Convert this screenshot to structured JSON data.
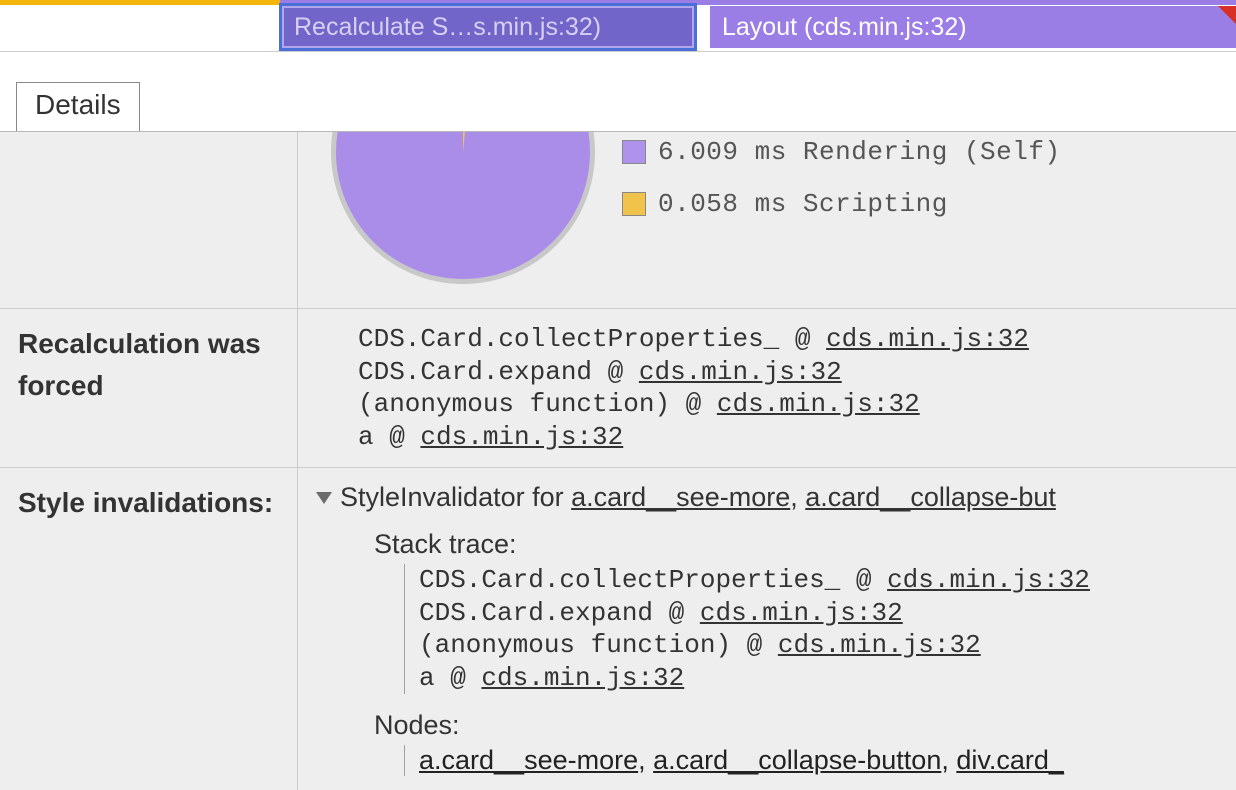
{
  "colors": {
    "rendering": "#af92eb",
    "scripting": "#f2c34b",
    "accent_scripting_bar": "#f3b509",
    "accent_rendering_bar": "#9a7ee6"
  },
  "timeline": {
    "recalc_label": "Recalculate S…s.min.js:32)",
    "layout_label": "Layout (cds.min.js:32)"
  },
  "tabs": {
    "details": "Details"
  },
  "chart_data": {
    "type": "pie",
    "title": "",
    "series": [
      {
        "name": "Rendering (Self)",
        "value_ms": 6.009,
        "color": "#af92eb"
      },
      {
        "name": "Scripting",
        "value_ms": 0.058,
        "color": "#f2c34b"
      }
    ]
  },
  "legend": {
    "rendering": "6.009 ms Rendering (Self)",
    "scripting": "0.058 ms Scripting"
  },
  "rows": {
    "recalc_label": "Recalculation was forced",
    "style_inv_label": "Style invalidations:"
  },
  "stack": {
    "l0_fn": "CDS.Card.collectProperties_ @ ",
    "l0_loc": "cds.min.js:32",
    "l1_fn": "CDS.Card.expand @ ",
    "l1_loc": "cds.min.js:32",
    "l2_fn": "(anonymous function) @ ",
    "l2_loc": "cds.min.js:32",
    "l3_fn": "a @ ",
    "l3_loc": "cds.min.js:32"
  },
  "invalidation": {
    "prefix": "StyleInvalidator for ",
    "node0": "a.card__see-more",
    "sep": ", ",
    "node1": "a.card__collapse-but",
    "stack_title": "Stack trace:",
    "nodes_title": "Nodes:",
    "nodes_l0_a": "a.card__see-more",
    "nodes_l0_b": "a.card__collapse-button",
    "nodes_l0_c": "div.card_"
  }
}
